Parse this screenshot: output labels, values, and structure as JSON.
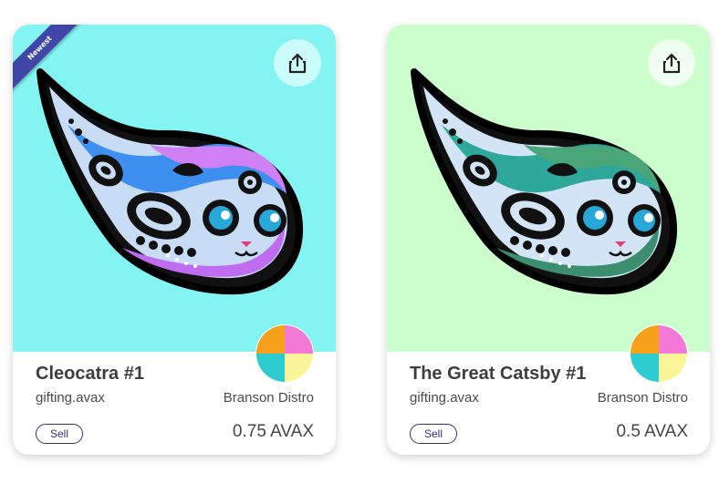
{
  "colors": {
    "card_0_background": "#84f4f2",
    "card_0_share_bg": "#cbfbfb",
    "card_1_background": "#ccfdcc",
    "card_1_share_bg": "#effef0",
    "ribbon": "#3f46a8",
    "sell_border": "#2f2f8a"
  },
  "cards": [
    {
      "ribbon_label": "Newest",
      "title": "Cleocatra #1",
      "handle": "gifting.avax",
      "creator": "Branson Distro",
      "action_label": "Sell",
      "price": "0.75 AVAX",
      "share_icon": "share-icon"
    },
    {
      "title": "The Great Catsby #1",
      "handle": "gifting.avax",
      "creator": "Branson Distro",
      "action_label": "Sell",
      "price": "0.5 AVAX",
      "share_icon": "share-icon"
    }
  ]
}
